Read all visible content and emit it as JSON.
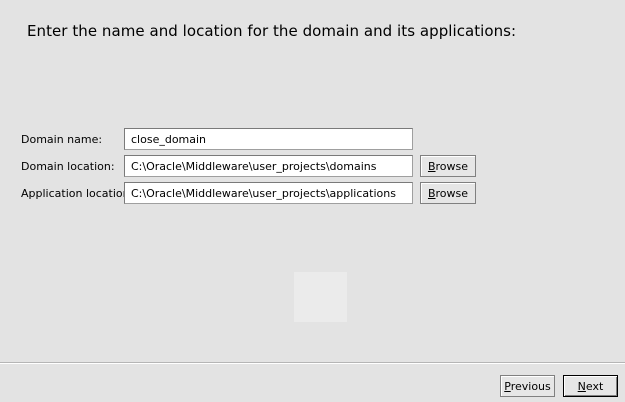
{
  "header": {
    "title": "Enter the name and location for the domain and its applications:"
  },
  "form": {
    "domain_name": {
      "label": "Domain name:",
      "value": "close_domain"
    },
    "domain_location": {
      "label": "Domain location:",
      "value": "C:\\Oracle\\Middleware\\user_projects\\domains",
      "browse_label_mnemonic": "B",
      "browse_label_rest": "rowse"
    },
    "application_location": {
      "label": "Application location:",
      "value": "C:\\Oracle\\Middleware\\user_projects\\applications",
      "browse_label_mnemonic": "B",
      "browse_label_rest": "rowse"
    }
  },
  "footer": {
    "previous_label_mnemonic": "P",
    "previous_label_rest": "revious",
    "next_label_mnemonic": "N",
    "next_label_rest": "ext"
  }
}
